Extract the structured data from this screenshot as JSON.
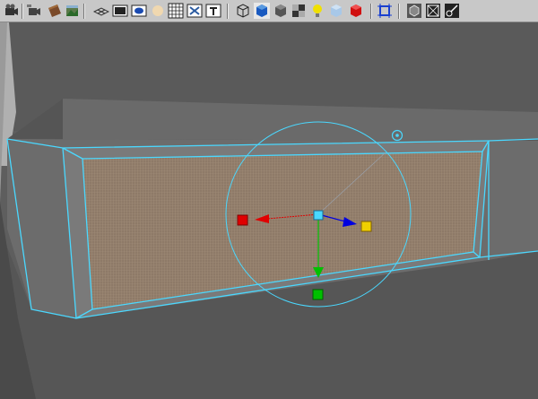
{
  "toolbar": {
    "buttons": [
      {
        "name": "camera-attributes-icon"
      },
      {
        "name": "camera-tools-icon"
      },
      {
        "name": "bookmarks-icon"
      },
      {
        "name": "image-plane-icon"
      },
      {
        "name": "grid-icon"
      },
      {
        "name": "film-gate-icon"
      },
      {
        "name": "resolution-gate-icon"
      },
      {
        "name": "gate-mask-icon"
      },
      {
        "name": "field-chart-icon"
      },
      {
        "name": "safe-action-icon"
      },
      {
        "name": "safe-title-icon"
      },
      {
        "name": "wireframe-icon"
      },
      {
        "name": "smooth-shade-icon"
      },
      {
        "name": "default-material-icon"
      },
      {
        "name": "shadows-icon"
      },
      {
        "name": "use-all-lights-icon"
      },
      {
        "name": "xray-icon"
      },
      {
        "name": "isolate-select-icon"
      },
      {
        "name": "wireframe-on-shaded-icon"
      },
      {
        "name": "backface-culling-icon"
      },
      {
        "name": "resolution-frame-icon"
      },
      {
        "name": "film-back-icon"
      }
    ]
  },
  "viewport": {
    "colors": {
      "background": "#5e5e5e",
      "selection": "#4ad8ff",
      "mesh_panel": "#8e7a68",
      "x_axis": "#e00000",
      "y_axis": "#00c000",
      "z_axis": "#0000e0",
      "center_handle": "#ffe000"
    },
    "manipulator": "move-manipulator"
  }
}
